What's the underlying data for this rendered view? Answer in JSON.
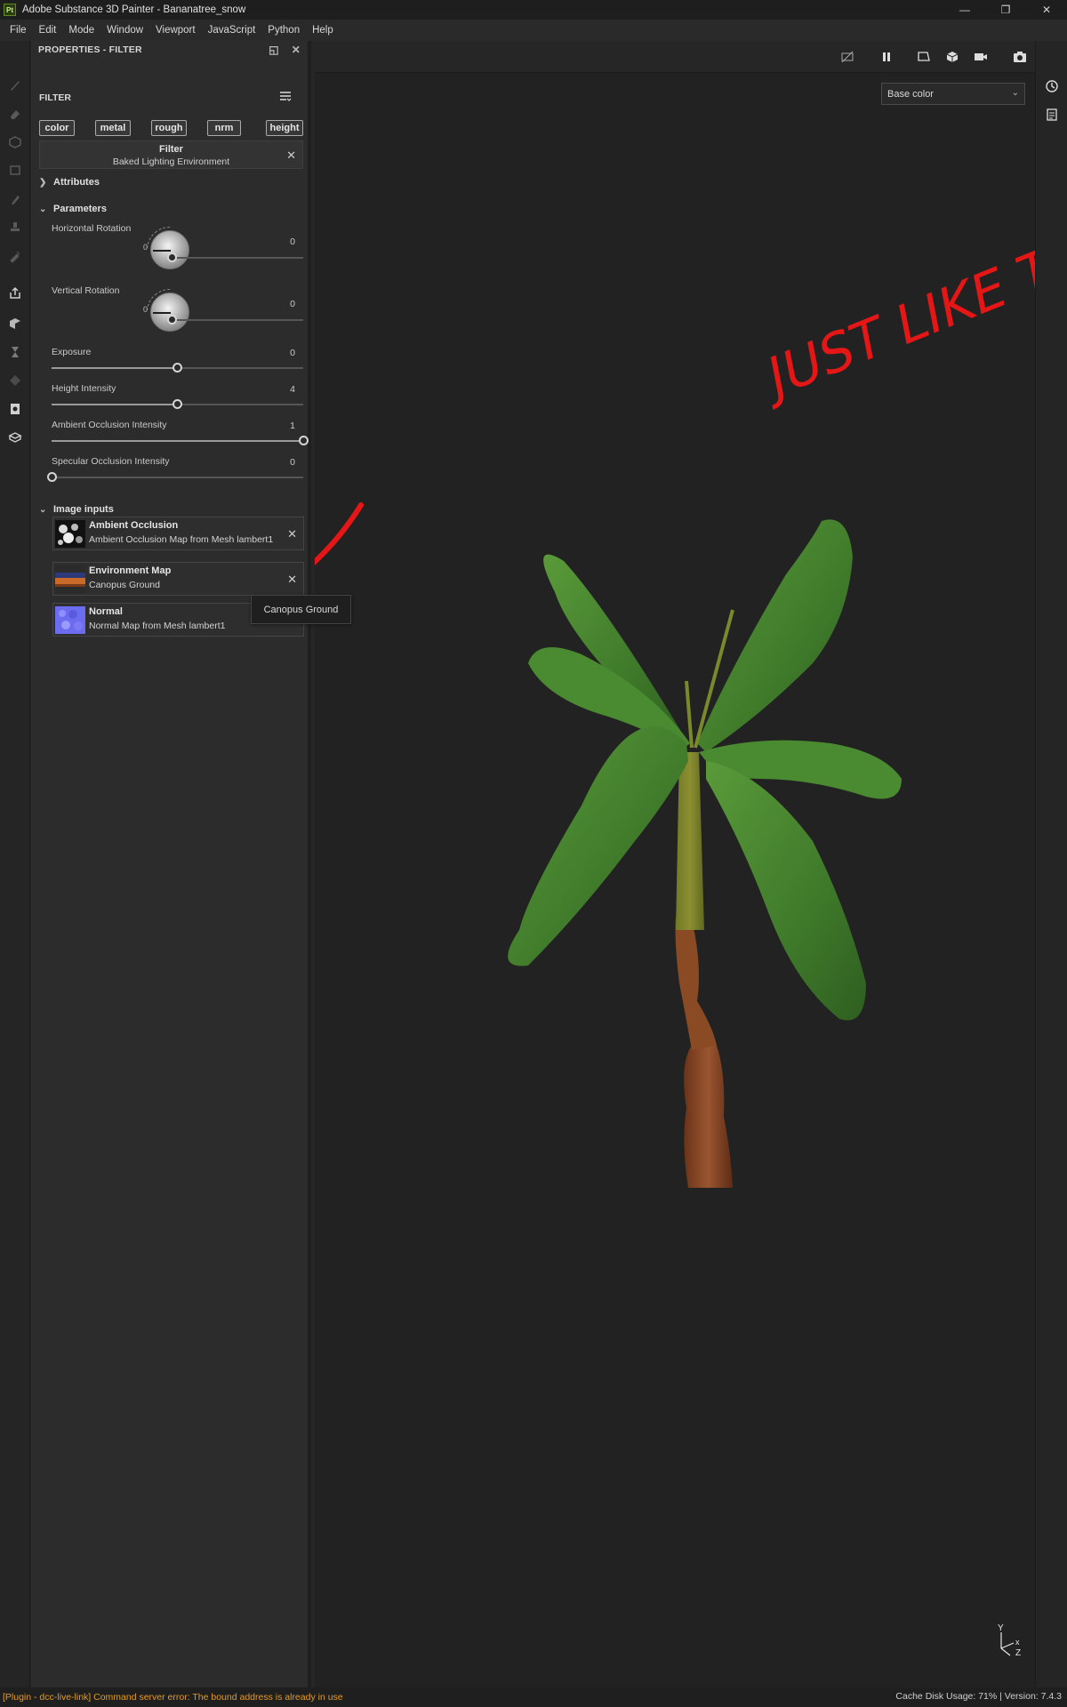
{
  "window": {
    "title": "Adobe Substance 3D Painter - Bananatree_snow",
    "logo": "Pt"
  },
  "menu": [
    "File",
    "Edit",
    "Mode",
    "Window",
    "Viewport",
    "JavaScript",
    "Python",
    "Help"
  ],
  "panel": {
    "header": "PROPERTIES - FILTER",
    "section_title": "FILTER",
    "channels": [
      "color",
      "metal",
      "rough",
      "nrm",
      "height"
    ],
    "filter": {
      "title": "Filter",
      "name": "Baked Lighting Environment"
    },
    "attributes_label": "Attributes",
    "parameters_label": "Parameters",
    "params": {
      "horizontal_rotation": {
        "label": "Horizontal Rotation",
        "value": "0",
        "dial_zero": "0"
      },
      "vertical_rotation": {
        "label": "Vertical Rotation",
        "value": "0",
        "dial_zero": "0"
      },
      "exposure": {
        "label": "Exposure",
        "value": "0",
        "fraction": 0.5
      },
      "height_intensity": {
        "label": "Height Intensity",
        "value": "4",
        "fraction": 0.5
      },
      "ao_intensity": {
        "label": "Ambient Occlusion Intensity",
        "value": "1",
        "fraction": 1.0
      },
      "specular_occlusion": {
        "label": "Specular Occlusion Intensity",
        "value": "0",
        "fraction": 0.0
      }
    },
    "image_inputs_label": "Image inputs",
    "image_inputs": [
      {
        "title": "Ambient Occlusion",
        "subtitle": "Ambient Occlusion Map from Mesh lambert1"
      },
      {
        "title": "Environment Map",
        "subtitle": "Canopus Ground"
      },
      {
        "title": "Normal",
        "subtitle": "Normal Map from Mesh lambert1"
      }
    ],
    "tooltip": "Canopus Ground"
  },
  "viewport": {
    "channel_select": "Base color",
    "annotation_text": "JUST LIKE THIS",
    "axis_labels": {
      "y": "Y",
      "x": "x",
      "z": "Z"
    }
  },
  "status": {
    "error": "[Plugin - dcc-live-link] Command server error: The bound address is already in use",
    "right": "Cache Disk Usage:   71% | Version: 7.4.3"
  },
  "colors": {
    "annotation": "#e51616",
    "error_text": "#e49a23",
    "leaf": "#4f8a30",
    "trunk": "#8b4a25"
  }
}
